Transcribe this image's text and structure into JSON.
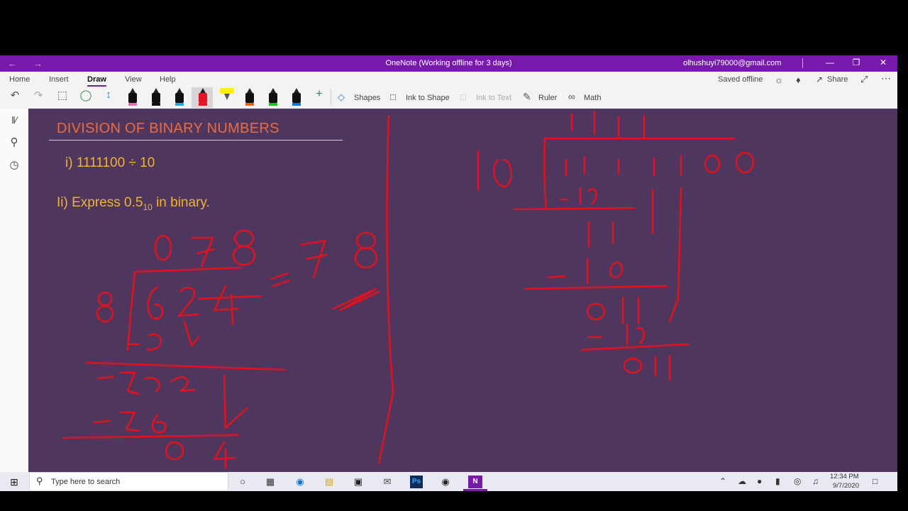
{
  "window": {
    "title": "OneNote (Working offline for 3 days)",
    "account": "olhushuyi79000@gmail.com",
    "back_icon": "arrow-left-icon",
    "forward_icon": "arrow-right-icon"
  },
  "ribbon": {
    "tabs": [
      "Home",
      "Insert",
      "Draw",
      "View",
      "Help"
    ],
    "active_tab": "Draw",
    "status": "Saved offline",
    "share_label": "Share",
    "shapes_label": "Shapes",
    "ink_to_shape_label": "Ink to Shape",
    "ink_to_text_label": "Ink to Text",
    "ruler_label": "Ruler",
    "math_label": "Math",
    "pen_colors": [
      "#e66fb0",
      "#111111",
      "#21a7e0",
      "#e81224",
      "#fff100",
      "#f7630c",
      "#16c60c",
      "#0078d4"
    ],
    "accent": "#7719aa"
  },
  "page": {
    "heading": "DIVISION OF BINARY NUMBERS",
    "question1": "i) 1111100 ÷ 10",
    "question2_prefix": "Ii) Express 0.5",
    "question2_sub": "10",
    "question2_suffix": " in binary.",
    "background": "#4f365f",
    "ink_color": "#e4101c"
  },
  "taskbar": {
    "search_placeholder": "Type here to search",
    "time": "12:34 PM",
    "date": "9/7/2020"
  }
}
